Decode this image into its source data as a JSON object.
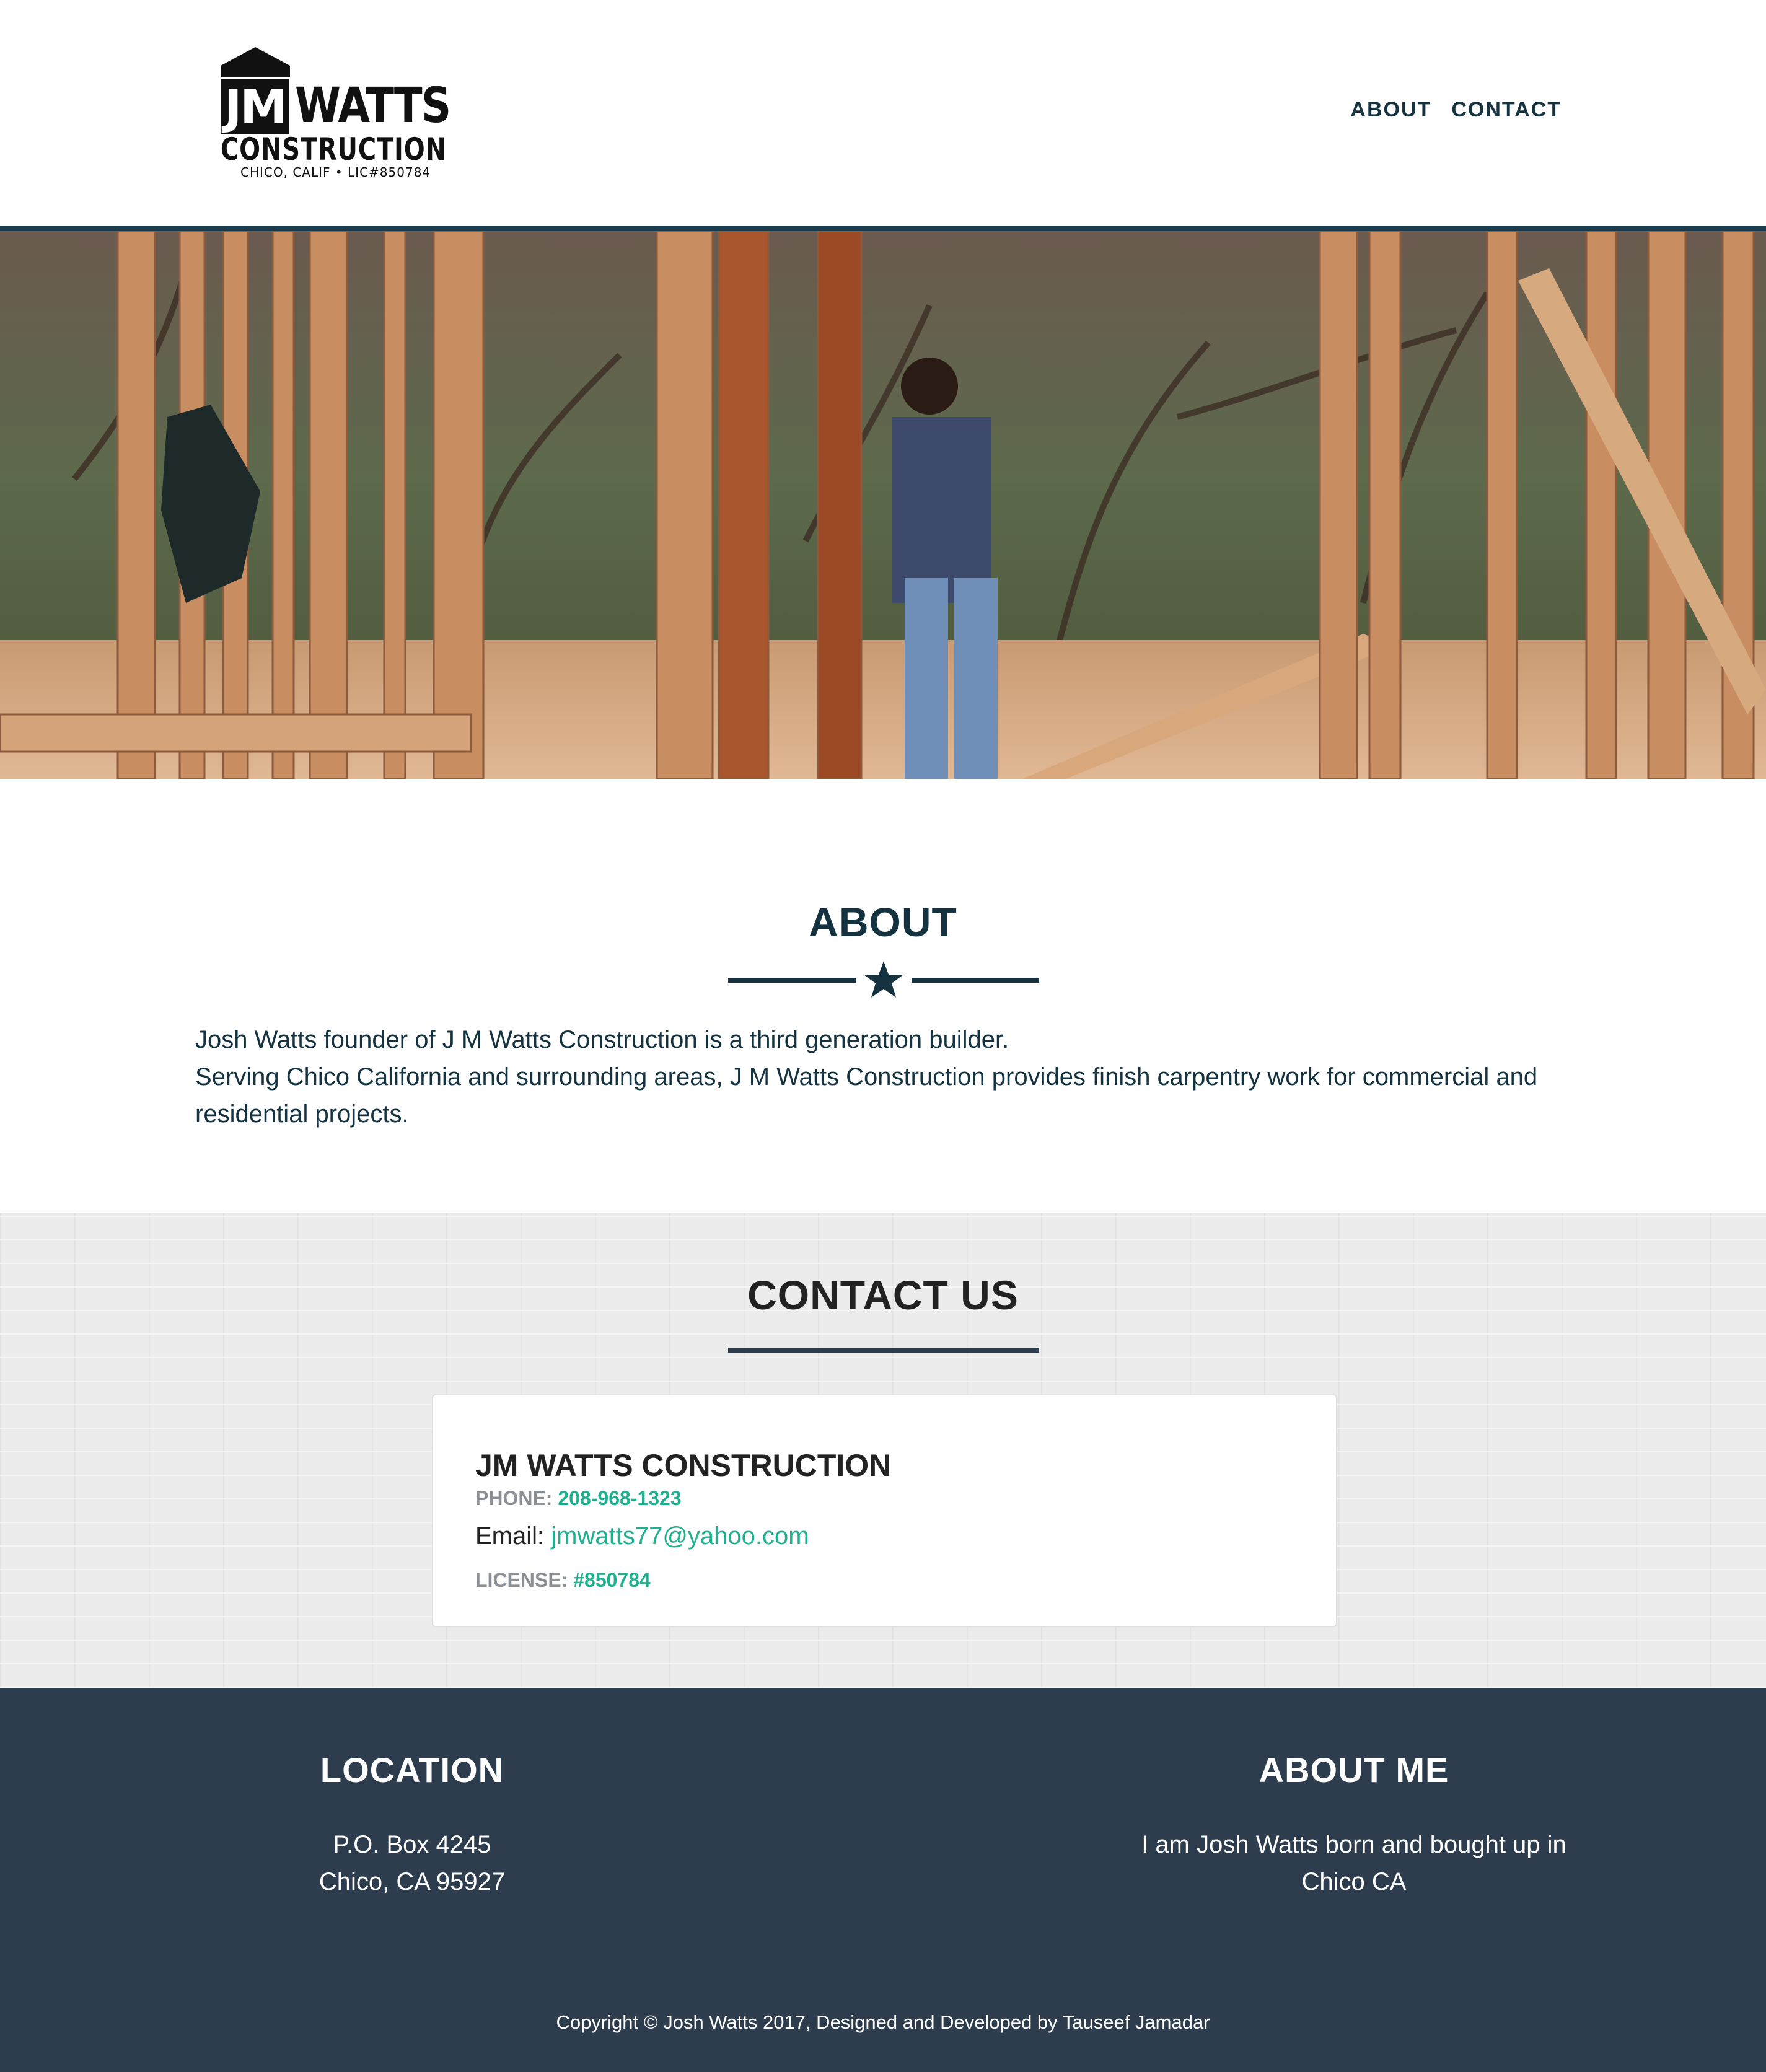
{
  "brand": {
    "logo_initials": "JM",
    "logo_name": "WATTS",
    "logo_subtitle": "CONSTRUCTION",
    "logo_tagline": "CHICO, CALIF • LIC#850784"
  },
  "nav": {
    "items": [
      {
        "label": "ABOUT"
      },
      {
        "label": "CONTACT"
      }
    ]
  },
  "hero": {
    "slide_count": 3,
    "active_slide": 2
  },
  "about": {
    "title": "ABOUT",
    "line1": "Josh Watts founder of J M Watts Construction is a third generation builder.",
    "line2": "Serving Chico California and surrounding areas, J M Watts Construction provides finish carpentry work for commercial and residential projects."
  },
  "contact": {
    "title": "CONTACT US",
    "company": "JM WATTS CONSTRUCTION",
    "phone_label": "PHONE:",
    "phone": "208-968-1323",
    "email_label": "Email:",
    "email": "jmwatts77@yahoo.com",
    "license_label": "LICENSE:",
    "license": "#850784"
  },
  "footer": {
    "location_title": "LOCATION",
    "location_line1": "P.O. Box 4245",
    "location_line2": "Chico, CA 95927",
    "about_title": "ABOUT ME",
    "about_text": "I am Josh Watts born and bought up in Chico CA",
    "copyright": "Copyright © Josh Watts 2017, Designed and Developed by Tauseef Jamadar"
  },
  "colors": {
    "navy": "#14323f",
    "accent_teal": "#1fb08f",
    "footer_bg": "#2e3d4e",
    "contact_bg": "#ececec"
  }
}
